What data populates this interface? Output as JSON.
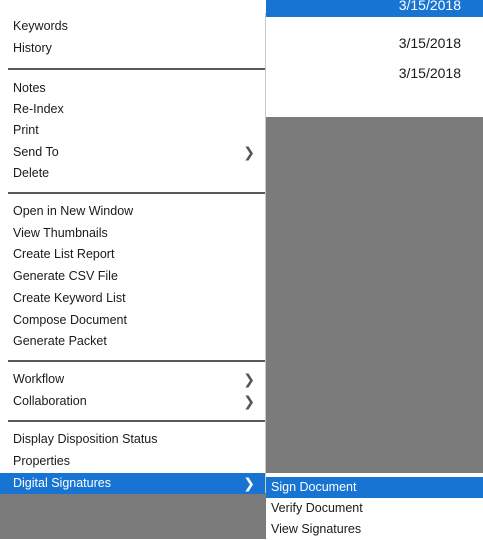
{
  "results": {
    "rows": [
      {
        "date": "3/15/2018",
        "selected": true
      },
      {
        "date": "3/15/2018",
        "selected": false
      },
      {
        "date": "3/15/2018",
        "selected": false
      }
    ]
  },
  "context_menu": {
    "groups": [
      [
        {
          "label": "Keywords"
        },
        {
          "label": "History"
        }
      ],
      [
        {
          "label": "Notes"
        },
        {
          "label": "Re-Index"
        },
        {
          "label": "Print"
        },
        {
          "label": "Send To",
          "submenu_icon": "chevron-right-icon"
        },
        {
          "label": "Delete"
        }
      ],
      [
        {
          "label": "Open in New Window"
        },
        {
          "label": "View Thumbnails"
        },
        {
          "label": "Create List Report"
        },
        {
          "label": "Generate CSV File"
        },
        {
          "label": "Create Keyword List"
        },
        {
          "label": "Compose Document"
        },
        {
          "label": "Generate Packet"
        }
      ],
      [
        {
          "label": "Workflow",
          "submenu_icon": "chevron-right-icon"
        },
        {
          "label": "Collaboration",
          "submenu_icon": "chevron-right-icon"
        }
      ],
      [
        {
          "label": "Display Disposition Status"
        },
        {
          "label": "Properties"
        },
        {
          "label": "Digital Signatures",
          "submenu_icon": "chevron-right-icon",
          "active": true
        }
      ]
    ]
  },
  "digital_signatures_submenu": {
    "items": [
      {
        "label": "Sign Document",
        "active": true
      },
      {
        "label": "Verify Document"
      },
      {
        "label": "View Signatures"
      }
    ]
  },
  "colors": {
    "highlight": "#1874d2",
    "backdrop": "#7b7b7b"
  }
}
